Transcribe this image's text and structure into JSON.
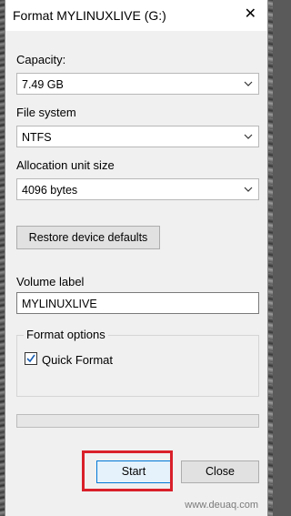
{
  "window": {
    "title": "Format MYLINUXLIVE (G:)"
  },
  "capacity": {
    "label": "Capacity:",
    "value": "7.49 GB"
  },
  "file_system": {
    "label": "File system",
    "value": "NTFS"
  },
  "allocation": {
    "label": "Allocation unit size",
    "value": "4096 bytes"
  },
  "restore_button": "Restore device defaults",
  "volume": {
    "label": "Volume label",
    "value": "MYLINUXLIVE"
  },
  "format_options": {
    "title": "Format options",
    "quick_format": {
      "label": "Quick Format",
      "checked": true
    }
  },
  "progress": {
    "percent": 0
  },
  "buttons": {
    "start": "Start",
    "close": "Close"
  },
  "watermark": "www.deuaq.com",
  "colors": {
    "highlight": "#d9202a",
    "focus": "#0078d7",
    "check": "#1a5fb4"
  }
}
